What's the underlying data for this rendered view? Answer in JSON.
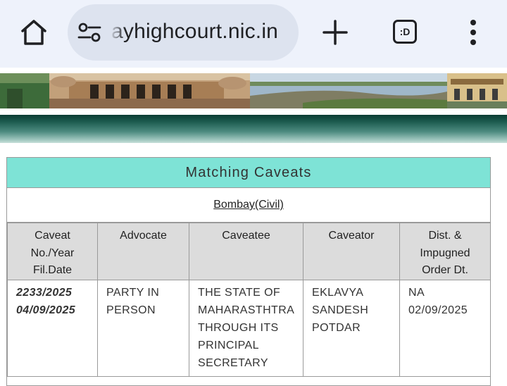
{
  "browser": {
    "url": "ayhighcourt.nic.in",
    "tabs_label": ":D",
    "icons": [
      "home-icon",
      "tune-icon",
      "plus-icon",
      "tab-switcher-icon",
      "more-vert-icon"
    ]
  },
  "panel": {
    "title": "Matching Caveats",
    "bench": "Bombay(Civil)",
    "title_bg": "#7ee3d6"
  },
  "table": {
    "headers": {
      "caveat": [
        "Caveat",
        "No./Year",
        "Fil.Date"
      ],
      "advocate": [
        "Advocate"
      ],
      "caveatee": [
        "Caveatee"
      ],
      "caveator": [
        "Caveator"
      ],
      "dist": [
        "Dist. &",
        "Impugned",
        "Order Dt."
      ]
    },
    "rows": [
      {
        "caveat": [
          "2233/2025",
          "04/09/2025"
        ],
        "advocate": [
          "PARTY IN",
          "PERSON"
        ],
        "caveatee": [
          "THE STATE OF",
          "MAHARASTHTRA",
          "THROUGH ITS",
          "PRINCIPAL",
          "SECRETARY"
        ],
        "caveator": [
          "EKLAVYA",
          "SANDESH",
          "POTDAR"
        ],
        "dist": [
          "NA",
          "02/09/2025"
        ]
      }
    ]
  }
}
